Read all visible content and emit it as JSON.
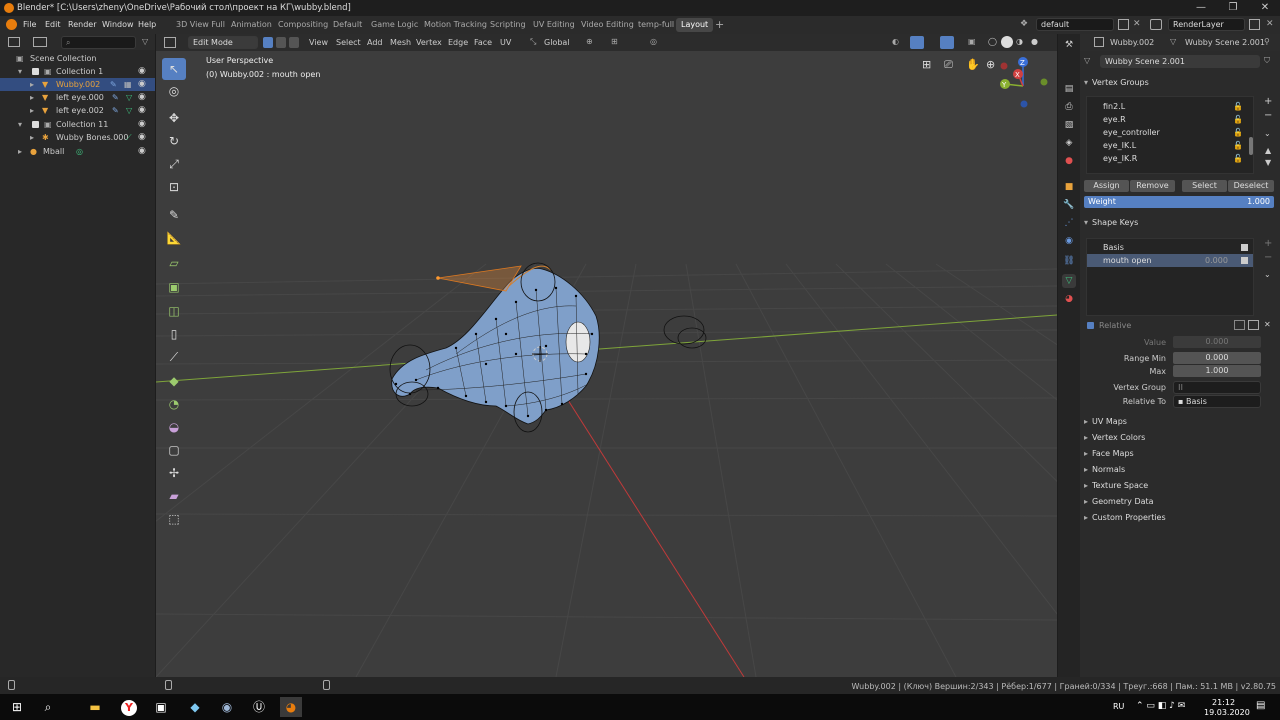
{
  "window": {
    "title": "Blender* [C:\\Users\\zheny\\OneDrive\\Рабочий стол\\проект на КГ\\wubby.blend]",
    "minimize": "—",
    "maximize": "❐",
    "close": "✕"
  },
  "menu": [
    "File",
    "Edit",
    "Render",
    "Window",
    "Help"
  ],
  "workspaces": [
    "3D View Full",
    "Animation",
    "Compositing",
    "Default",
    "Game Logic",
    "Motion Tracking",
    "Scripting",
    "UV Editing",
    "Video Editing",
    "temp-full",
    "Layout"
  ],
  "active_workspace": "Layout",
  "add_workspace": "+",
  "scene_name": "default",
  "render_layer": "RenderLayer",
  "outliner": {
    "rows": [
      {
        "label": "Scene Collection",
        "indent": 0
      },
      {
        "label": "Collection 1",
        "indent": 1
      },
      {
        "label": "Wubby.002",
        "indent": 2,
        "active": true
      },
      {
        "label": "left eye.000",
        "indent": 2
      },
      {
        "label": "left eye.002",
        "indent": 2
      },
      {
        "label": "Collection 11",
        "indent": 1
      },
      {
        "label": "Wubby Bones.000",
        "indent": 2
      },
      {
        "label": "Mball",
        "indent": 1
      }
    ]
  },
  "viewport": {
    "mode": "Edit Mode",
    "menus": [
      "View",
      "Select",
      "Add",
      "Mesh",
      "Vertex",
      "Edge",
      "Face",
      "UV"
    ],
    "orientation": "Global",
    "overlay_title": "User Perspective",
    "overlay_sub": "(0) Wubby.002 : mouth open",
    "gizmo": {
      "x": "X",
      "y": "Y",
      "z": "Z"
    }
  },
  "properties": {
    "object_name": "Wubby.002",
    "data_name": "Wubby Scene 2.001",
    "mesh_field": "Wubby Scene 2.001",
    "vertex_groups_title": "Vertex Groups",
    "vertex_groups": [
      "fin2.L",
      "eye.R",
      "eye_controller",
      "eye_IK.L",
      "eye_IK.R"
    ],
    "buttons": {
      "assign": "Assign",
      "remove": "Remove",
      "select": "Select",
      "deselect": "Deselect"
    },
    "weight_label": "Weight",
    "weight_value": "1.000",
    "shape_keys_title": "Shape Keys",
    "shape_keys": [
      {
        "name": "Basis",
        "value": ""
      },
      {
        "name": "mouth open",
        "value": "0.000"
      }
    ],
    "relative_label": "Relative",
    "value_label": "Value",
    "value": "0.000",
    "range_min_label": "Range Min",
    "range_min": "0.000",
    "max_label": "Max",
    "max": "1.000",
    "vertex_group_label": "Vertex Group",
    "relative_to_label": "Relative To",
    "relative_to": "Basis",
    "collapsed_sections": [
      "UV Maps",
      "Vertex Colors",
      "Face Maps",
      "Normals",
      "Texture Space",
      "Geometry Data",
      "Custom Properties"
    ]
  },
  "status": "Wubby.002 | (Ключ) Вершин:2/343 | Рёбер:1/677 | Граней:0/334 | Треуг.:668 | Пам.: 51.1 MB | v2.80.75",
  "taskbar": {
    "lang": "RU",
    "time": "21:12",
    "date": "19.03.2020"
  },
  "colors": {
    "accent": "#5680c2",
    "active_text": "#e8a23c",
    "mesh": "#7f9fc9",
    "x_axis": "#c03a3a",
    "y_axis": "#7fa53a"
  }
}
